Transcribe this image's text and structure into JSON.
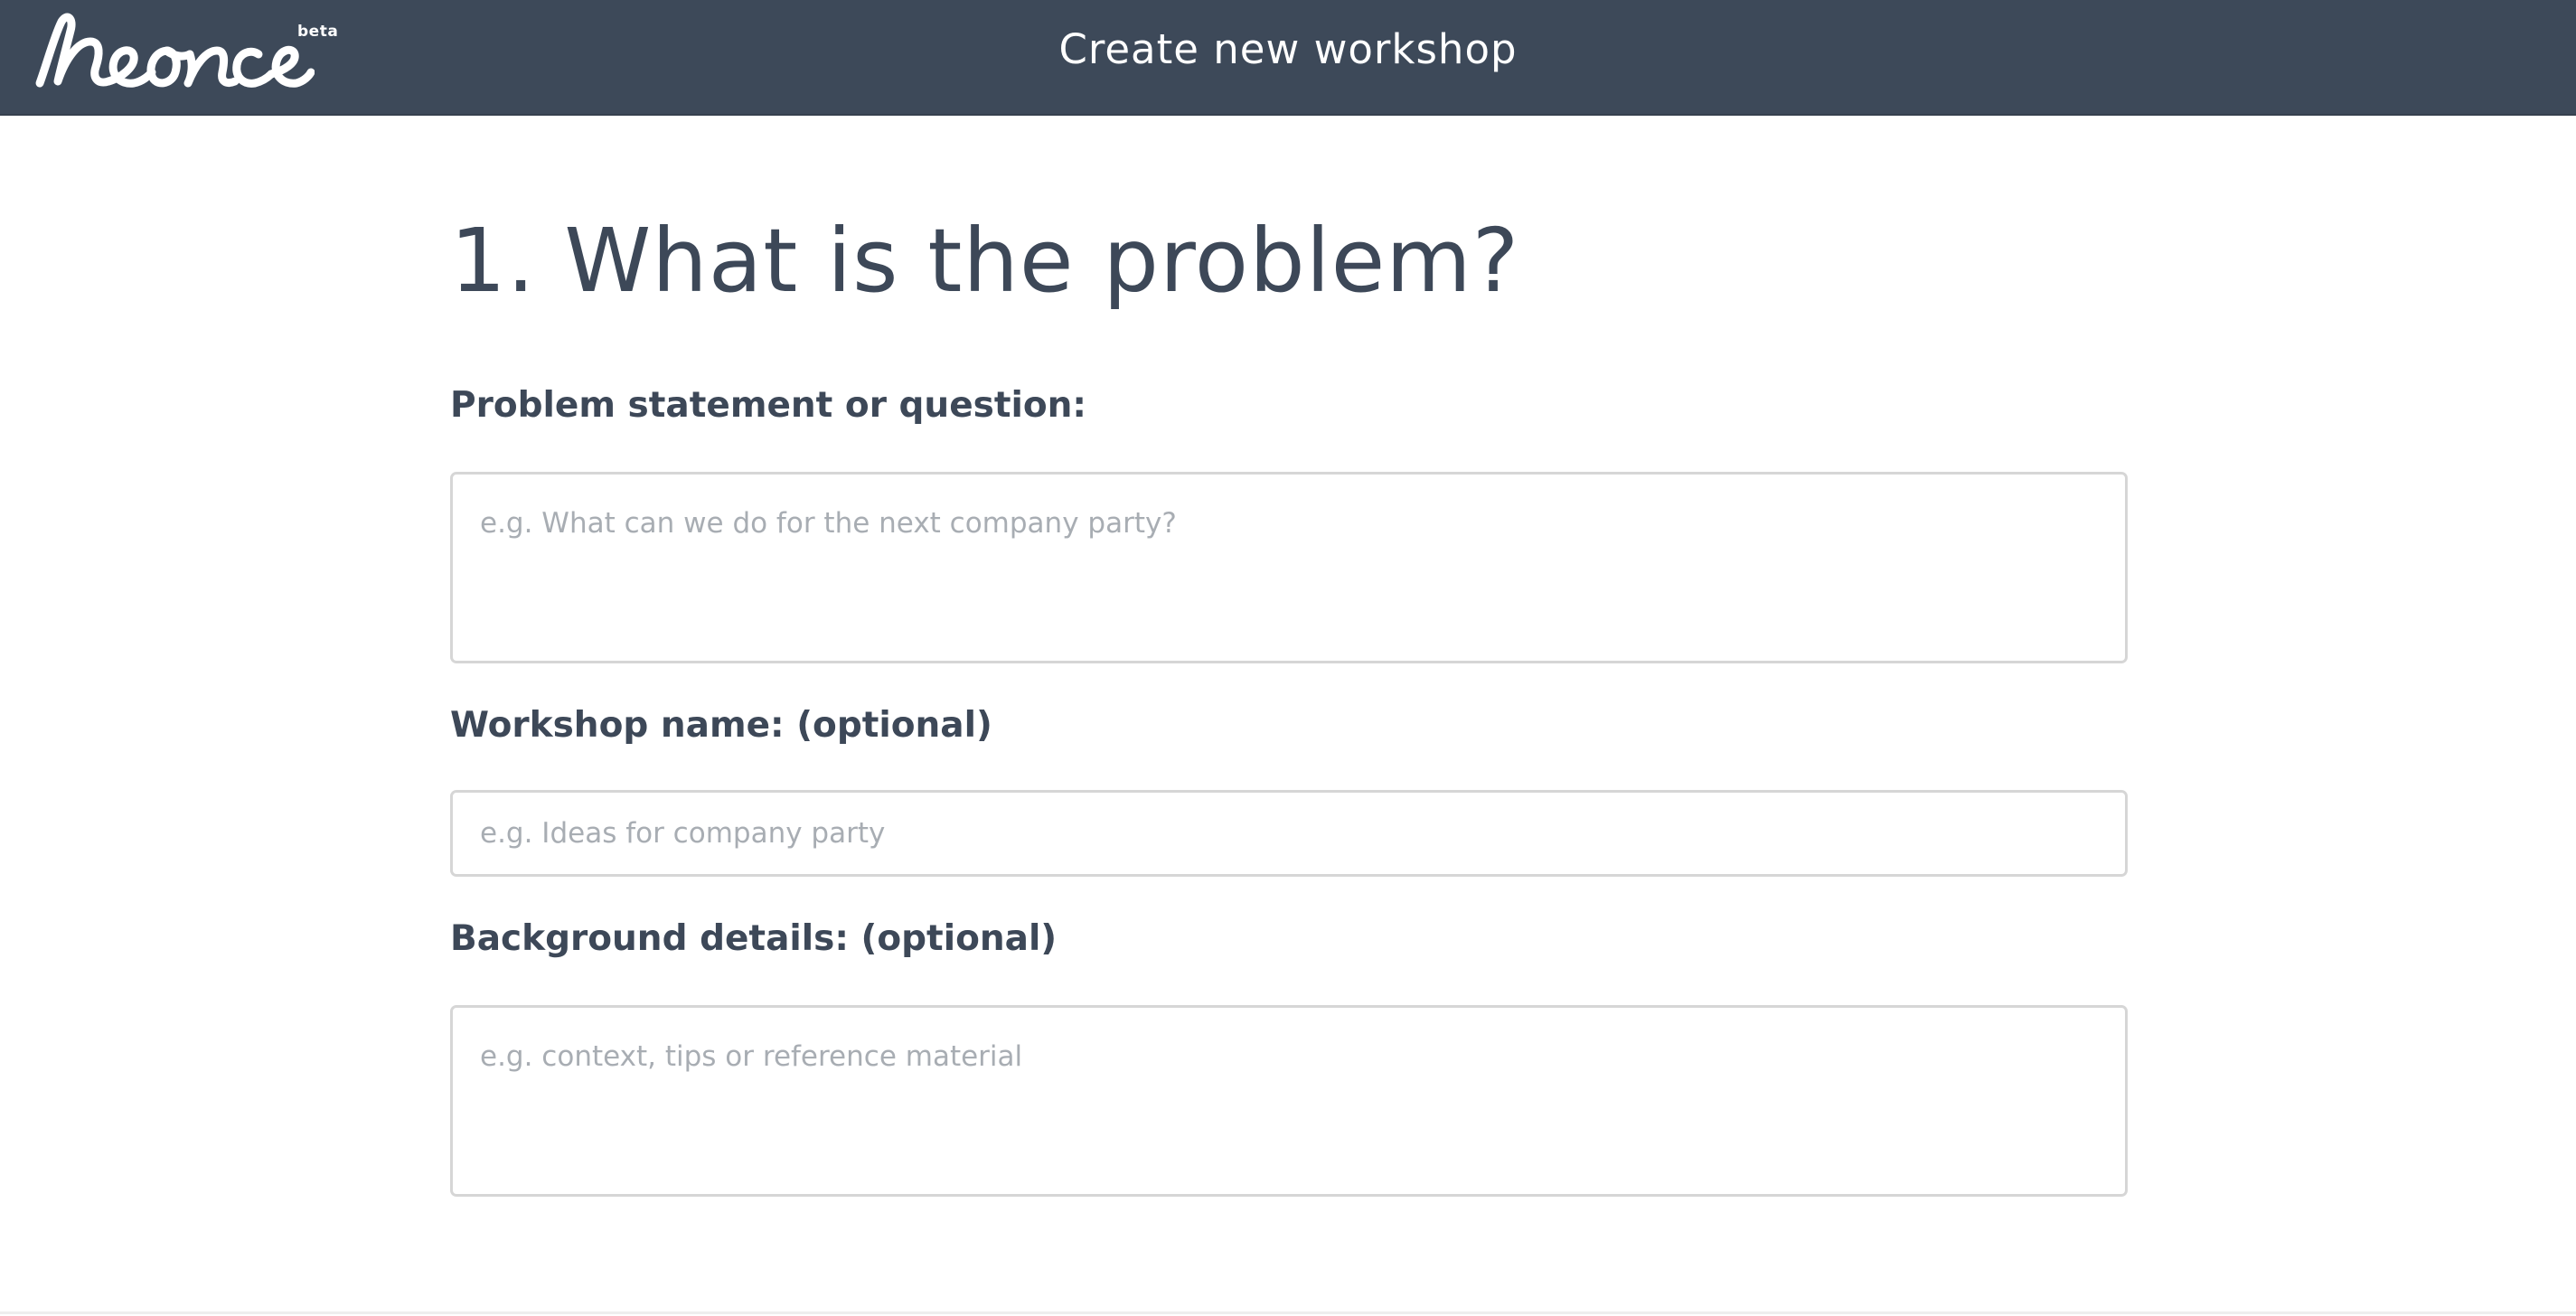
{
  "header": {
    "logo_text": "neonce",
    "logo_badge": "beta",
    "title": "Create new workshop"
  },
  "form": {
    "step_heading": "1. What is the problem?",
    "problem": {
      "label": "Problem statement or question:",
      "placeholder": "e.g. What can we do for the next company party?",
      "value": ""
    },
    "name": {
      "label": "Workshop name: (optional)",
      "placeholder": "e.g. Ideas for company party",
      "value": ""
    },
    "background": {
      "label": "Background details: (optional)",
      "placeholder": "e.g. context, tips or reference material",
      "value": ""
    }
  },
  "colors": {
    "header_bg": "#3d4959",
    "text": "#3d4858",
    "placeholder": "#a8adb3",
    "input_border": "#d6d6d6"
  }
}
